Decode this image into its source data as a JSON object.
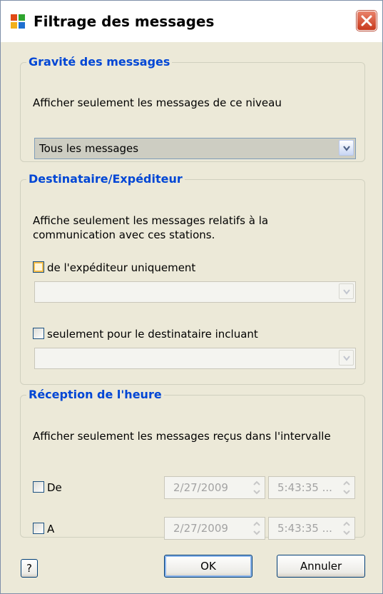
{
  "window": {
    "title": "Filtrage des messages"
  },
  "severity": {
    "legend": "Gravité des messages",
    "description": "Afficher seulement les messages de ce niveau",
    "combo_value": "Tous les messages"
  },
  "recipient": {
    "legend": "Destinataire/Expéditeur",
    "description_line1": "Affiche seulement les messages relatifs à la",
    "description_line2": "communication avec ces stations.",
    "sender_label": "de l'expéditeur uniquement",
    "sender_checked": false,
    "receiver_label": "seulement pour le destinataire incluant",
    "receiver_checked": false
  },
  "time": {
    "legend": "Réception de l'heure",
    "description": "Afficher seulement les messages reçus dans l'intervalle",
    "from": {
      "label": "De",
      "checked": false,
      "date": "2/27/2009",
      "time": "5:43:35 ..."
    },
    "to": {
      "label": "A",
      "checked": false,
      "date": "2/27/2009",
      "time": "5:43:35 ..."
    }
  },
  "buttons": {
    "help": "?",
    "ok": "OK",
    "cancel": "Annuler"
  },
  "colors": {
    "group_title": "#0046d5",
    "dialog_bg": "#ece9d8",
    "close_button": "#d5462a"
  }
}
